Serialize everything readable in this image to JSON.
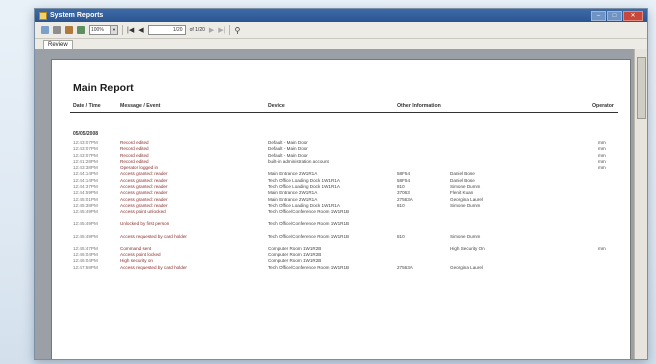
{
  "window": {
    "title": "System Reports"
  },
  "toolbar": {
    "zoom": "100%",
    "page_input": "1/20",
    "page_of": "of 1/20"
  },
  "tabs": [
    {
      "label": "Review"
    }
  ],
  "report": {
    "title": "Main Report",
    "columns": {
      "datetime": "Date / Time",
      "message": "Message / Event",
      "device": "Device",
      "other": "Other Information",
      "operator": "Operator"
    },
    "date_group": "05/05/2008",
    "rows": [
      {
        "time": "12:43:07PM",
        "message": "Record edited",
        "device": "Default - Main Door",
        "other1": "",
        "other2": "",
        "operator": "mm"
      },
      {
        "time": "12:43:07PM",
        "message": "Record edited",
        "device": "Default - Main Door",
        "other1": "",
        "other2": "",
        "operator": "mm"
      },
      {
        "time": "12:43:07PM",
        "message": "Record edited",
        "device": "Default - Main Door",
        "other1": "",
        "other2": "",
        "operator": "mm"
      },
      {
        "time": "12:41:28PM",
        "message": "Record edited",
        "device": "built-in administration account",
        "other1": "",
        "other2": "",
        "operator": "mm"
      },
      {
        "time": "12:43:38PM",
        "message": "Operator logged in",
        "device": "",
        "other1": "",
        "other2": "",
        "operator": "mm"
      },
      {
        "time": "12:44:14PM",
        "message": "Access granted: reader",
        "device": "Main Entrance 2W1R1A",
        "other1": "58F54",
        "other2": "Daniel Bose",
        "operator": ""
      },
      {
        "time": "12:44:14PM",
        "message": "Access granted: reader",
        "device": "Tech Office Loading Dock 1W1R1A",
        "other1": "58F54",
        "other2": "Daniel Bose",
        "operator": ""
      },
      {
        "time": "12:44:37PM",
        "message": "Access granted: reader",
        "device": "Tech Office Loading Dock 1W1R1A",
        "other1": "810",
        "other2": "Simone Dumm",
        "operator": ""
      },
      {
        "time": "12:44:59PM",
        "message": "Access granted: reader",
        "device": "Main Entrance 2W1R1A",
        "other1": "37063",
        "other2": "Flenit Kuan",
        "operator": ""
      },
      {
        "time": "12:45:01PM",
        "message": "Access granted: reader",
        "device": "Main Entrance 2W1R1A",
        "other1": "27563A",
        "other2": "Georgina Laurel",
        "operator": ""
      },
      {
        "time": "12:45:38PM",
        "message": "Access granted: reader",
        "device": "Tech Office Loading Dock 1W1R1A",
        "other1": "810",
        "other2": "Simone Dumm",
        "operator": ""
      },
      {
        "time": "12:45:49PM",
        "message": "Access point unlocked",
        "device": "Tech Office/Conference Room 1W1R1B",
        "other1": "",
        "other2": "",
        "operator": "",
        "tall": true
      },
      {
        "time": "12:45:49PM",
        "message": "Unlocked by first person",
        "device": "Tech Office/Conference Room 1W1R1B",
        "other1": "",
        "other2": "",
        "operator": "",
        "tall": true
      },
      {
        "time": "12:45:49PM",
        "message": "Access requested by card holder",
        "device": "Tech Office/Conference Room 1W1R1B",
        "other1": "810",
        "other2": "Simone Dumm",
        "operator": "",
        "tall": true
      },
      {
        "time": "12:45:47PM",
        "message": "Command sent",
        "device": "Computer Room 1W1R2B",
        "other1": "",
        "other2": "High Security On",
        "operator": "mm"
      },
      {
        "time": "12:46:04PM",
        "message": "Access point locked",
        "device": "Computer Room 1W1R2B",
        "other1": "",
        "other2": "",
        "operator": ""
      },
      {
        "time": "12:46:04PM",
        "message": "High security on",
        "device": "Computer Room 1W1R2B",
        "other1": "",
        "other2": "",
        "operator": ""
      },
      {
        "time": "12:47:58PM",
        "message": "Access requested by card holder",
        "device": "Tech Office/Conference Room 1W1R1B",
        "other1": "27563A",
        "other2": "Georgina Laurel",
        "operator": "",
        "tall": true
      }
    ]
  },
  "colors": {
    "title_bar": "#2b5590",
    "message_text": "#8a2b2b",
    "close_button": "#c9473a"
  }
}
